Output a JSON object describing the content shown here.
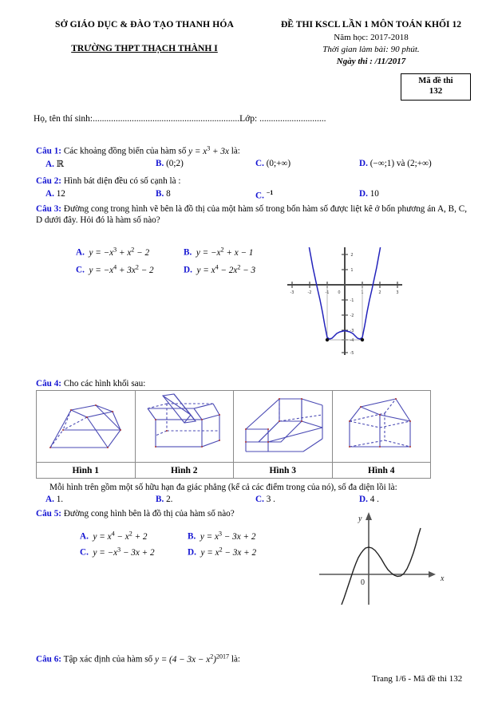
{
  "header": {
    "department": "SỞ GIÁO DỤC & ĐÀO TẠO THANH HÓA",
    "school": "TRƯỜNG THPT THẠCH THÀNH I",
    "exam_title": "ĐỀ THI KSCL LẦN 1 MÔN TOÁN KHỐI 12",
    "school_year": "Năm học: 2017-2018",
    "duration": "Thời gian làm bài: 90 phút.",
    "exam_date": "Ngày thi :  /11/2017",
    "code_label": "Mã đề thi",
    "code_value": "132"
  },
  "candidate": {
    "name_label": "Họ, tên thí sinh:",
    "name_dots": "................................................................",
    "class_label": "Lớp:",
    "class_dots": "............................."
  },
  "questions": [
    {
      "id": "q1",
      "label": "Câu 1:",
      "text_before": " Các khoảng đồng biến của hàm số ",
      "formula": "y = x³ + 3x",
      "text_after": " là:",
      "options": [
        {
          "letter": "A.",
          "text": "ℝ"
        },
        {
          "letter": "B.",
          "text": "(0;2)"
        },
        {
          "letter": "C.",
          "text": "(0;+∞)"
        },
        {
          "letter": "D.",
          "text": "(−∞;1) và (2;+∞)"
        }
      ]
    },
    {
      "id": "q2",
      "label": "Câu 2:",
      "text": " Hình bát diện đều có số cạnh là :",
      "options": [
        {
          "letter": "A.",
          "text": "12"
        },
        {
          "letter": "B.",
          "text": "8"
        },
        {
          "letter": "C.",
          "text": "−1"
        },
        {
          "letter": "D.",
          "text": "10"
        }
      ]
    },
    {
      "id": "q3",
      "label": "Câu 3:",
      "text": " Đường cong trong hình vẽ bên là đồ thị của một hàm số trong bốn hàm số được liệt kê ở bốn phương án A, B, C, D dưới đây. Hỏi đó là hàm số nào?",
      "options": [
        {
          "letter": "A.",
          "text": "y = −x³ + x² − 2"
        },
        {
          "letter": "B.",
          "text": "y = −x² + x − 1"
        },
        {
          "letter": "C.",
          "text": "y = −x⁴ + 3x² − 2"
        },
        {
          "letter": "D.",
          "text": "y = x⁴ − 2x² − 3"
        }
      ]
    },
    {
      "id": "q4",
      "label": "Câu 4:",
      "text": " Cho các hình khối sau:",
      "figures": [
        {
          "name": "Hình 1",
          "shape": "frustum-pyramid"
        },
        {
          "name": "Hình 2",
          "shape": "box-with-prism-ridge"
        },
        {
          "name": "Hình 3",
          "shape": "u-channel-block"
        },
        {
          "name": "Hình 4",
          "shape": "house-prism"
        }
      ],
      "subtext": "Mỗi hình trên gồm một số hữu hạn đa giác phẳng (kể cả các điểm trong của nó), số đa diện lồi là:",
      "options": [
        {
          "letter": "A.",
          "text": "1."
        },
        {
          "letter": "B.",
          "text": "2."
        },
        {
          "letter": "C.",
          "text": "3 ."
        },
        {
          "letter": "D.",
          "text": "4 ."
        }
      ]
    },
    {
      "id": "q5",
      "label": "Câu 5:",
      "text": " Đường cong  hình bên là đồ thị của hàm số nào?",
      "options": [
        {
          "letter": "A.",
          "text": "y = x⁴ − x² + 2"
        },
        {
          "letter": "B.",
          "text": "y = x³ − 3x + 2"
        },
        {
          "letter": "C.",
          "text": "y = −x³ − 3x + 2"
        },
        {
          "letter": "D.",
          "text": "y = x² − 3x + 2"
        }
      ]
    },
    {
      "id": "q6",
      "label": "Câu 6:",
      "text_before": " Tập xác định của hàm số ",
      "formula": "y = (4 − 3x − x²)^2017",
      "text_after": " là:"
    }
  ],
  "graphs": {
    "q3": {
      "description": "quartic W-shaped curve",
      "x_ticks": [
        "-3",
        "-2",
        "-1",
        "0",
        "1",
        "2",
        "3"
      ],
      "y_ticks": [
        "2",
        "1",
        "-1",
        "-2",
        "-3",
        "-4",
        "-5"
      ],
      "curve_color": "#2222bb",
      "axis_color": "#444444"
    },
    "q5": {
      "description": "cubic curve",
      "y_label": "y",
      "x_label": "x",
      "origin_label": "0",
      "curve_color": "#222222",
      "axis_color": "#555555"
    }
  },
  "footer": {
    "text": "Trang 1/6 - Mã đề thi 132"
  },
  "colors": {
    "question_blue": "#1414d2",
    "figure_stroke": "#4a4ab4",
    "table_border": "#8a8a8a"
  }
}
